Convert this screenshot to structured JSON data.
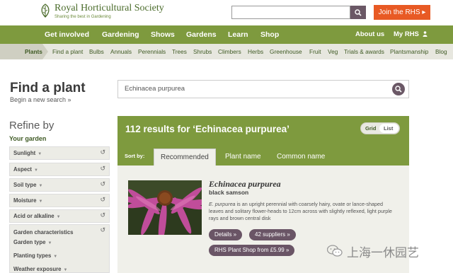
{
  "header": {
    "logo_name": "Royal Horticultural Society",
    "logo_tagline": "Sharing the best in Gardening",
    "join_label": "Join the RHS ▸"
  },
  "main_nav": {
    "items": [
      "Get involved",
      "Gardening",
      "Shows",
      "Gardens",
      "Learn",
      "Shop"
    ],
    "about": "About us",
    "my_rhs": "My RHS"
  },
  "sub_nav": {
    "items": [
      "Plants",
      "Find a plant",
      "Bulbs",
      "Annuals",
      "Perennials",
      "Trees",
      "Shrubs",
      "Climbers",
      "Herbs",
      "Greenhouse",
      "Fruit",
      "Veg",
      "Trials & awards",
      "Plantsmanship",
      "Blog"
    ]
  },
  "page": {
    "title": "Find a plant",
    "begin_new_search": "Begin a new search »",
    "refine_by": "Refine by",
    "your_garden": "Your garden"
  },
  "filters": [
    "Sunlight",
    "Aspect",
    "Soil type",
    "Moisture",
    "Acid or alkaline"
  ],
  "filter_group": {
    "title": "Garden characteristics",
    "items": [
      "Garden type",
      "Planting types",
      "Weather exposure"
    ]
  },
  "search": {
    "value": "Echinacea purpurea"
  },
  "results": {
    "title": "112 results for ‘Echinacea purpurea’",
    "view_grid": "Grid",
    "view_list": "List",
    "sort_by": "Sort by:",
    "tabs": [
      "Recommended",
      "Plant name",
      "Common name"
    ]
  },
  "plant": {
    "name": "Echinacea purpurea",
    "common_name": "black samson",
    "desc_species": "E. purpurea",
    "description": " is an upright perennial with coarsely hairy, ovate or lance-shaped leaves and solitary flower-heads to 12cm across with slightly reflexed, light purple rays and brown central disk",
    "details_label": "Details »",
    "suppliers_label": "42 suppliers »",
    "shop_label": "RHS Plant Shop from £5.99 »"
  },
  "watermark": {
    "text": "上海一休园艺"
  },
  "colors": {
    "brand_green": "#7e9a3e",
    "accent_orange": "#e85a24",
    "button_purple": "#6a5566"
  }
}
